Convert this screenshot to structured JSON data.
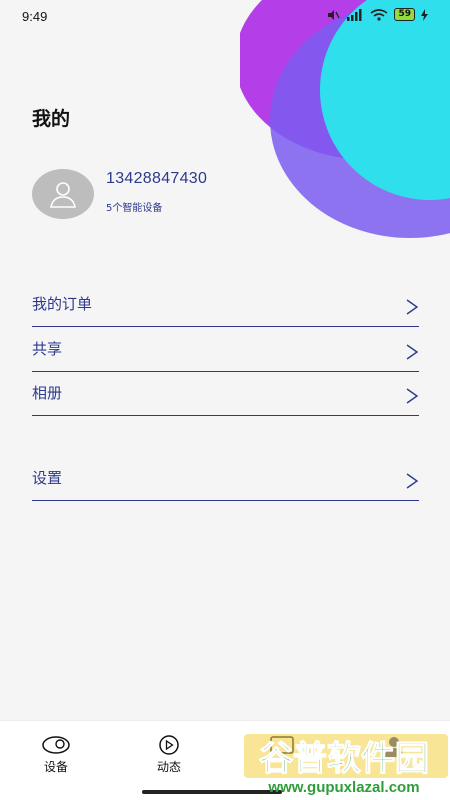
{
  "status_bar": {
    "time": "9:49",
    "battery": "59"
  },
  "header": {
    "title": "我的"
  },
  "profile": {
    "phone": "13428847430",
    "device_count": "5个智能设备"
  },
  "menu": {
    "items": [
      {
        "label": "我的订单",
        "icon": "chevron-right-icon"
      },
      {
        "label": "共享",
        "icon": "chevron-right-icon"
      },
      {
        "label": "相册",
        "icon": "chevron-right-icon"
      },
      {
        "label": "设置",
        "icon": "chevron-right-icon"
      }
    ]
  },
  "bottom_nav": {
    "tabs": [
      {
        "label": "设备",
        "icon": "device-icon"
      },
      {
        "label": "动态",
        "icon": "play-icon"
      },
      {
        "label": "",
        "icon": "gallery-icon"
      },
      {
        "label": "",
        "icon": "profile-icon",
        "active": true
      }
    ]
  },
  "watermark": {
    "line1": "谷普软件园",
    "line2": "www.gupuxlazal.com"
  },
  "colors": {
    "accent": "#2d3a8c",
    "blob_purple": "#b43ee8",
    "blob_violet": "#7b5cf0",
    "blob_cyan": "#2fe0ec"
  }
}
